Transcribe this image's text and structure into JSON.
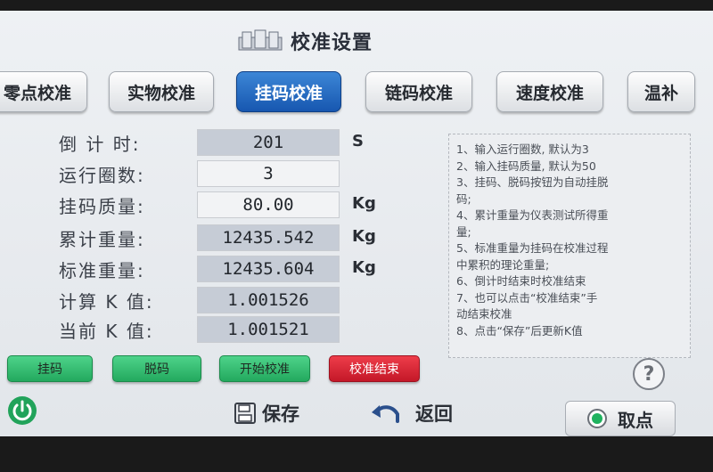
{
  "title": "校准设置",
  "tabs": [
    {
      "label": "零点校准"
    },
    {
      "label": "实物校准"
    },
    {
      "label": "挂码校准",
      "active": true
    },
    {
      "label": "链码校准"
    },
    {
      "label": "速度校准"
    },
    {
      "label": "温补"
    }
  ],
  "form": {
    "countdown": {
      "label": "倒 计 时:",
      "value": "201",
      "unit": "S"
    },
    "laps": {
      "label": "运行圈数:",
      "value": "3"
    },
    "weight_mass": {
      "label": "挂码质量:",
      "value": "80.00",
      "unit": "Kg"
    },
    "cumulative": {
      "label": "累计重量:",
      "value": "12435.542",
      "unit": "Kg"
    },
    "standard": {
      "label": "标准重量:",
      "value": "12435.604",
      "unit": "Kg"
    },
    "calc_k": {
      "label": "计算 K 值:",
      "value": "1.001526"
    },
    "current_k": {
      "label": "当前 K 值:",
      "value": "1.001521"
    }
  },
  "info_lines": [
    "1、输入运行圈数, 默认为3",
    "2、输入挂码质量, 默认为50",
    "3、挂码、脱码按钮为自动挂脱",
    "码;",
    "4、累计重量为仪表测试所得重",
    "量;",
    "5、标准重量为挂码在校准过程",
    "中累积的理论重量;",
    "6、倒计时结束时校准结束",
    "7、也可以点击“校准结束”手",
    "动结束校准",
    "8、点击“保存”后更新K值"
  ],
  "help_label": "?",
  "actions": {
    "hang": "挂码",
    "unhang": "脱码",
    "start": "开始校准",
    "end": "校准结束"
  },
  "bottom": {
    "save": "保存",
    "back": "返回",
    "pick": "取点"
  },
  "colors": {
    "active_tab": "#1f66bf",
    "green_button": "#2fbf6f",
    "red_button": "#dd2534",
    "power_icon": "#21a35a"
  }
}
